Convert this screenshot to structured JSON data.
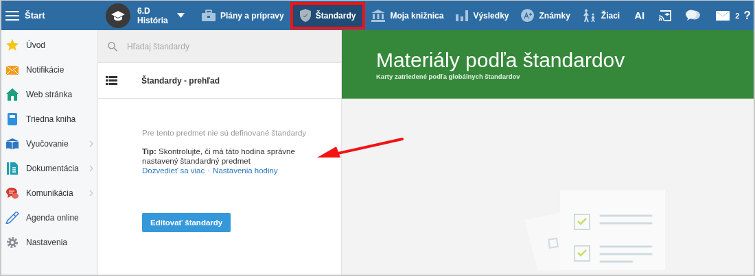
{
  "topbar": {
    "home_label": "Štart",
    "class_selector": {
      "class_name": "6.D",
      "subject": "História"
    },
    "nav_items": [
      {
        "kind": "briefcase",
        "label": "Plány a prípravy",
        "selected": false,
        "highlighted": false
      },
      {
        "kind": "shield",
        "label": "Štandardy",
        "selected": true,
        "highlighted": true
      },
      {
        "kind": "library",
        "label": "Moja knižnica",
        "selected": false,
        "highlighted": false
      },
      {
        "kind": "chart",
        "label": "Výsledky",
        "selected": false,
        "highlighted": false
      },
      {
        "kind": "grade",
        "label": "Známky",
        "selected": false,
        "highlighted": false
      },
      {
        "kind": "pupils",
        "label": "Žiaci",
        "selected": false,
        "highlighted": false
      }
    ],
    "ai_label": "AI",
    "mail_count": "2",
    "help_label": "?"
  },
  "sidebar": {
    "items": [
      {
        "kind": "star",
        "label": "Úvod",
        "has_submenu": false
      },
      {
        "kind": "envelope",
        "label": "Notifikácie",
        "has_submenu": false
      },
      {
        "kind": "house",
        "label": "Web stránka",
        "has_submenu": false
      },
      {
        "kind": "book",
        "label": "Triedna kniha",
        "has_submenu": false
      },
      {
        "kind": "openbook",
        "label": "Vyučovanie",
        "has_submenu": true
      },
      {
        "kind": "document",
        "label": "Dokumentácia",
        "has_submenu": true
      },
      {
        "kind": "chat",
        "label": "Komunikácia",
        "has_submenu": true
      },
      {
        "kind": "pen",
        "label": "Agenda online",
        "has_submenu": false
      },
      {
        "kind": "gear",
        "label": "Nastavenia",
        "has_submenu": false
      }
    ]
  },
  "standards_panel": {
    "search": {
      "placeholder": "Hľadaj štandardy"
    },
    "overview_label": "Štandardy - prehľad",
    "empty_message": "Pre tento predmet nie sú definované štandardy",
    "tip": "**Tip:** Skontrolujte, či má táto hodina správne nastavený štandardný predmet",
    "links": [
      "Dozvedieť sa viac",
      "Nastavenia hodiny"
    ],
    "link_separator": "·",
    "edit_button": "Editovať štandardy"
  },
  "materials": {
    "title": "Materiály podľa štandardov",
    "subtitle": "Karty zatriedené podľa globálnych štandardov"
  },
  "annotation_arrow": true
}
